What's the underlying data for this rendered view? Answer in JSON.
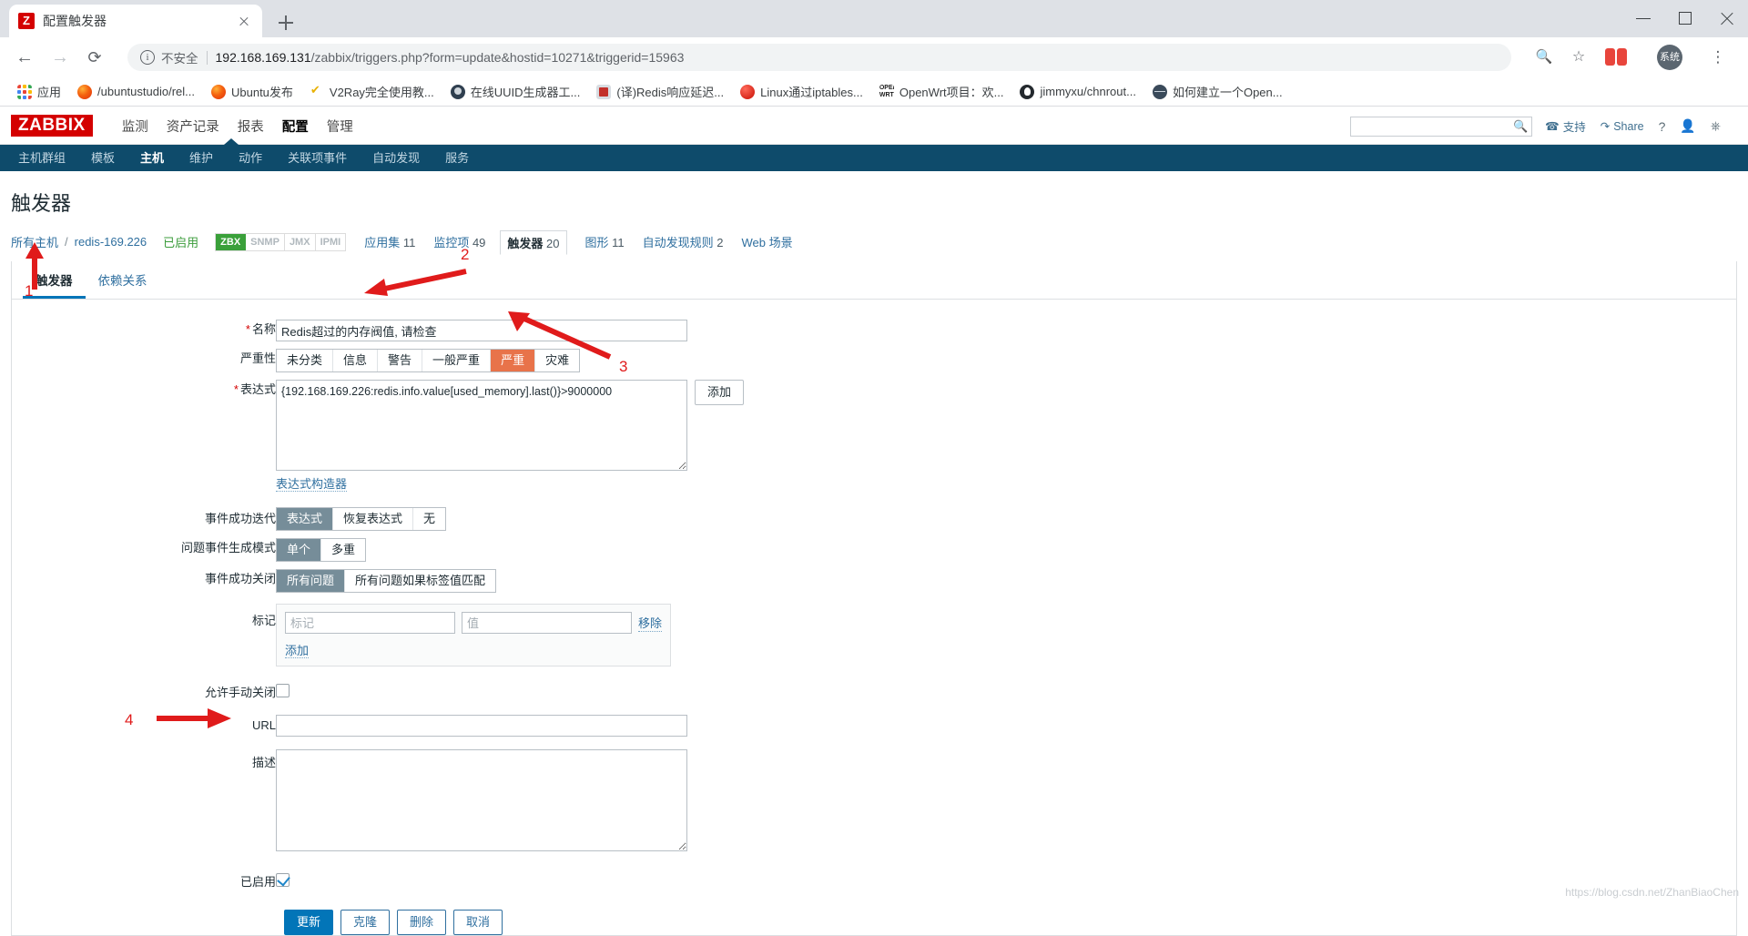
{
  "browser": {
    "tab": {
      "title": "配置触发器",
      "favicon_label": "Z",
      "favicon_icon": "zabbix-favicon",
      "close_icon": "close-icon"
    },
    "new_tab_icon": "plus-icon",
    "window_controls": {
      "minimize": "minimize-icon",
      "maximize": "maximize-icon",
      "close": "close-icon"
    },
    "nav": {
      "back_icon": "←",
      "forward_icon": "→",
      "reload_icon": "⟳"
    },
    "omnibox": {
      "info_icon": "i",
      "security_label": "不安全",
      "url_host": "192.168.169.131",
      "url_path": "/zabbix/triggers.php?form=update&hostid=10271&triggerid=15963"
    },
    "toolbar_icons": {
      "zoom": "🔍",
      "star": "☆",
      "extension": "extension-icon",
      "profile_label": "系统",
      "menu": "⋮"
    },
    "bookmarks": [
      {
        "label": "应用",
        "icon": "apps-grid-icon"
      },
      {
        "label": "/ubuntustudio/rel...",
        "icon": "firefox-icon"
      },
      {
        "label": "Ubuntu发布",
        "icon": "firefox-icon"
      },
      {
        "label": "V2Ray完全使用教...",
        "icon": "v2ray-icon"
      },
      {
        "label": "在线UUID生成器工...",
        "icon": "uuid-icon"
      },
      {
        "label": "(译)Redis响应延迟...",
        "icon": "redis-icon"
      },
      {
        "label": "Linux通过iptables...",
        "icon": "linux-icon"
      },
      {
        "label": "OpenWrt项目：欢...",
        "icon": "openwrt-icon"
      },
      {
        "label": "jimmyxu/chnrout...",
        "icon": "github-icon"
      },
      {
        "label": "如何建立一个Open...",
        "icon": "globe-icon"
      }
    ]
  },
  "zabbix": {
    "logo": "ZABBIX",
    "main_nav": [
      {
        "label": "监测",
        "active": false
      },
      {
        "label": "资产记录",
        "active": false
      },
      {
        "label": "报表",
        "active": false
      },
      {
        "label": "配置",
        "active": true
      },
      {
        "label": "管理",
        "active": false
      }
    ],
    "header_right": {
      "search_placeholder": "",
      "search_value": "",
      "search_icon": "search-icon",
      "support_label": "支持",
      "support_icon": "headset-icon",
      "share_label": "Share",
      "share_icon": "share-icon",
      "help_icon": "?",
      "user_icon": "user-icon",
      "signout_icon": "power-icon"
    },
    "sub_nav": [
      {
        "label": "主机群组",
        "active": false
      },
      {
        "label": "模板",
        "active": false
      },
      {
        "label": "主机",
        "active": true
      },
      {
        "label": "维护",
        "active": false
      },
      {
        "label": "动作",
        "active": false
      },
      {
        "label": "关联项事件",
        "active": false
      },
      {
        "label": "自动发现",
        "active": false
      },
      {
        "label": "服务",
        "active": false
      }
    ],
    "page_title": "触发器",
    "breadcrumb": {
      "all_hosts": "所有主机",
      "separator": "/",
      "host": "redis-169.226",
      "status": "已启用",
      "interfaces": [
        {
          "label": "ZBX",
          "enabled": true
        },
        {
          "label": "SNMP",
          "enabled": false
        },
        {
          "label": "JMX",
          "enabled": false
        },
        {
          "label": "IPMI",
          "enabled": false
        }
      ],
      "links": [
        {
          "label": "应用集",
          "count": "11",
          "selected": false
        },
        {
          "label": "监控项",
          "count": "49",
          "selected": false
        },
        {
          "label": "触发器",
          "count": "20",
          "selected": true
        },
        {
          "label": "图形",
          "count": "11",
          "selected": false
        },
        {
          "label": "自动发现规则",
          "count": "2",
          "selected": false
        },
        {
          "label": "Web 场景",
          "count": "",
          "selected": false
        }
      ]
    },
    "form_tabs": [
      {
        "label": "触发器",
        "active": true
      },
      {
        "label": "依赖关系",
        "active": false
      }
    ],
    "form": {
      "name": {
        "label": "名称",
        "required": true,
        "value": "Redis超过的内存阀值, 请检查"
      },
      "severity": {
        "label": "严重性",
        "options": [
          "未分类",
          "信息",
          "警告",
          "一般严重",
          "严重",
          "灾难"
        ],
        "selected": "严重"
      },
      "expression": {
        "label": "表达式",
        "required": true,
        "value": "{192.168.169.226:redis.info.value[used_memory].last()}>9000000",
        "add_button": "添加",
        "constructor_link": "表达式构造器"
      },
      "ok_event_generation": {
        "label": "事件成功迭代",
        "options": [
          "表达式",
          "恢复表达式",
          "无"
        ],
        "selected": "表达式"
      },
      "problem_event_generation": {
        "label": "问题事件生成模式",
        "options": [
          "单个",
          "多重"
        ],
        "selected": "单个"
      },
      "ok_event_closes": {
        "label": "事件成功关闭",
        "options": [
          "所有问题",
          "所有问题如果标签值匹配"
        ],
        "selected": "所有问题"
      },
      "tags": {
        "label": "标记",
        "tag_placeholder": "标记",
        "tag_value": "",
        "value_placeholder": "值",
        "value_value": "",
        "remove_label": "移除",
        "add_label": "添加"
      },
      "allow_manual_close": {
        "label": "允许手动关闭",
        "checked": false
      },
      "url": {
        "label": "URL",
        "value": ""
      },
      "description": {
        "label": "描述",
        "value": ""
      },
      "enabled": {
        "label": "已启用",
        "checked": true
      }
    },
    "footer_buttons": [
      {
        "label": "更新",
        "primary": true
      },
      {
        "label": "克隆",
        "primary": false
      },
      {
        "label": "删除",
        "primary": false
      },
      {
        "label": "取消",
        "primary": false
      }
    ]
  },
  "annotations": {
    "markers": [
      "1",
      "2",
      "3",
      "4"
    ],
    "color": "#e01b1b"
  },
  "watermark": "https://blog.csdn.net/ZhanBiaoChen"
}
